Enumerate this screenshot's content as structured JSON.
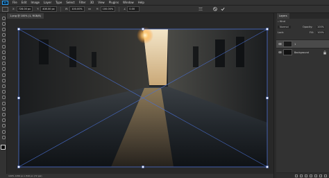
{
  "menubar": {
    "app_icon": "Ps",
    "items": [
      "File",
      "Edit",
      "Image",
      "Layer",
      "Type",
      "Select",
      "Filter",
      "3D",
      "View",
      "Plugins",
      "Window",
      "Help"
    ]
  },
  "options_bar": {
    "x_label": "X:",
    "x_value": "728.00 px",
    "y_label": "Y:",
    "y_value": "408.00 px",
    "w_label": "W:",
    "w_value": "100.00%",
    "h_label": "H:",
    "h_value": "100.00%",
    "angle_label": "∠",
    "angle_value": "0.00"
  },
  "document_tab": {
    "label": "1.png @ 100% (1, RGB/8)"
  },
  "status_bar": {
    "text": "100% 1456 px x 816 px (72 ppi)"
  },
  "layers_panel": {
    "tab_label": "Layers",
    "kind_label": "Kind",
    "blend_mode": "Normal",
    "opacity_label": "Opacity:",
    "opacity_value": "100%",
    "lock_label": "Lock:",
    "fill_label": "Fill:",
    "fill_value": "100%",
    "layers": [
      {
        "name": "1",
        "selected": true
      },
      {
        "name": "Background",
        "selected": false
      }
    ]
  },
  "colors": {
    "accent": "#31a8ff",
    "transform_box": "#4a6fd0",
    "panel_bg": "#323232",
    "workspace_bg": "#282828"
  }
}
